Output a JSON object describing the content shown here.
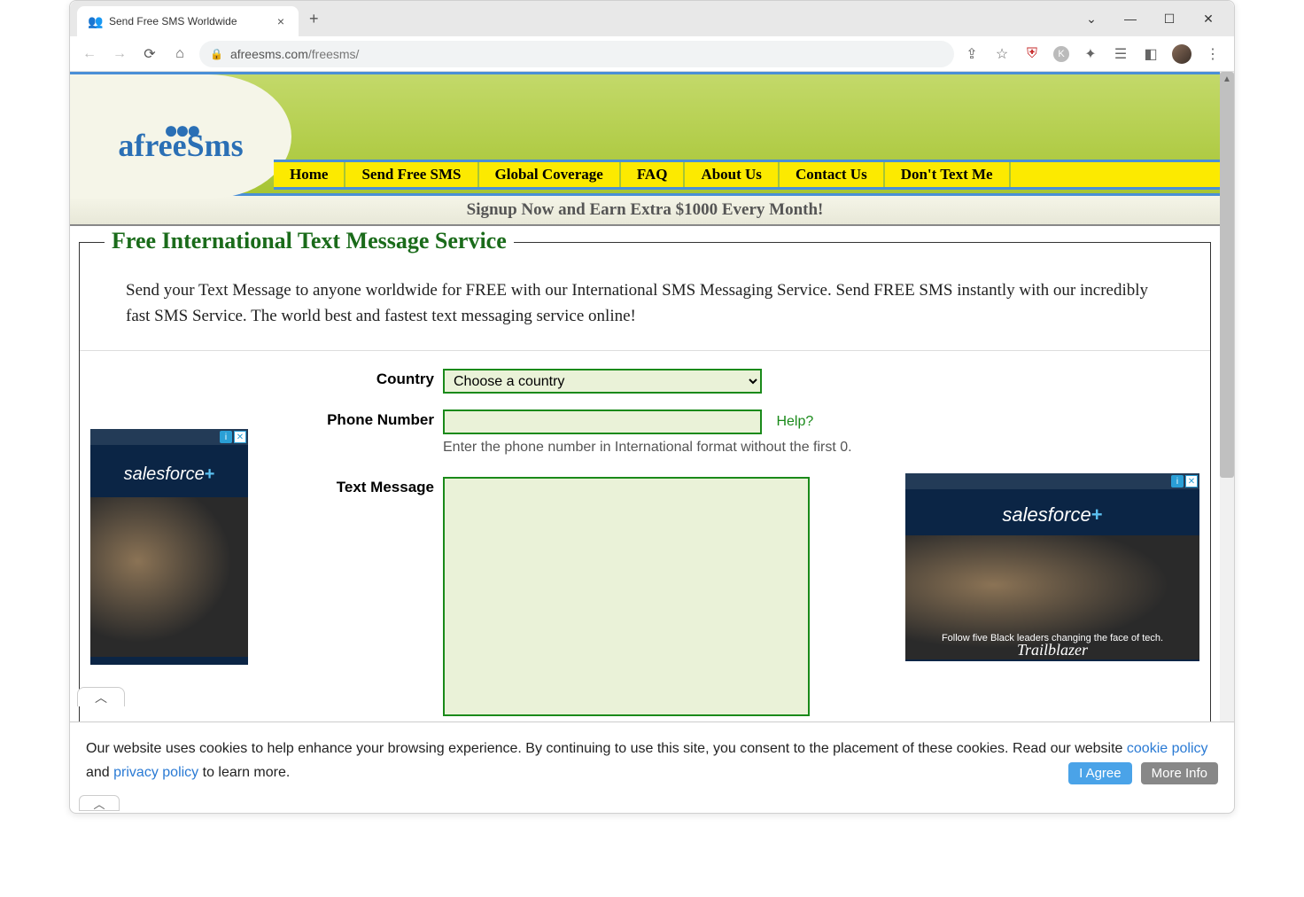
{
  "browser": {
    "tab_title": "Send Free SMS Worldwide",
    "url_domain": "afreesms.com",
    "url_path": "/freesms/"
  },
  "header": {
    "logo_text": "afreeSms"
  },
  "nav": {
    "items": [
      "Home",
      "Send Free SMS",
      "Global Coverage",
      "FAQ",
      "About Us",
      "Contact Us",
      "Don't Text Me"
    ]
  },
  "promo": {
    "text": "Signup Now and Earn Extra $1000 Every Month!"
  },
  "main": {
    "title": "Free International Text Message Service",
    "intro": "Send your Text Message to anyone worldwide for FREE with our International SMS Messaging Service. Send FREE SMS instantly with our incredibly fast SMS Service. The world best and fastest text messaging service online!"
  },
  "form": {
    "country_label": "Country",
    "country_value": "Choose a country",
    "phone_label": "Phone Number",
    "phone_value": "",
    "help_link": "Help?",
    "phone_hint": "Enter the phone number in International format without the first 0.",
    "message_label": "Text Message",
    "message_value": ""
  },
  "ads": {
    "brand": "salesforce",
    "caption": "Follow five Black leaders changing the face of tech.",
    "subtext": "Trailblazer"
  },
  "cookie": {
    "text_1": "Our website uses cookies to help enhance your browsing experience. By continuing to use this site, you consent to the placement of these cookies. Read our website ",
    "link_1": "cookie policy",
    "text_2": " and ",
    "link_2": "privacy policy",
    "text_3": " to learn more.",
    "agree": "I Agree",
    "more": "More Info"
  }
}
